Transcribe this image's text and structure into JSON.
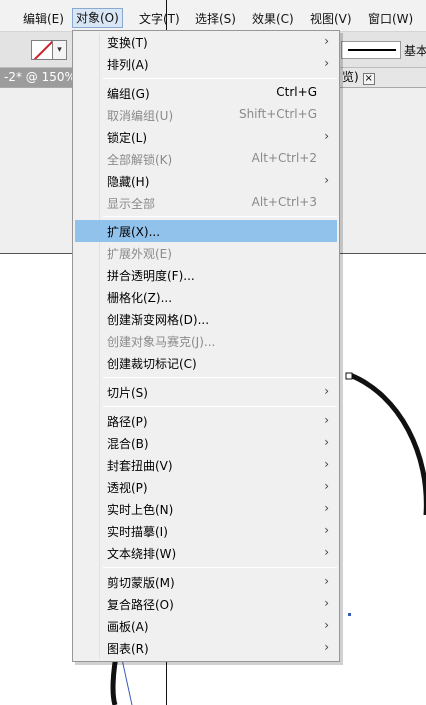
{
  "menubar": {
    "items": [
      {
        "label": "编辑(E)"
      },
      {
        "label": "对象(O)"
      },
      {
        "label": "文字(T)"
      },
      {
        "label": "选择(S)"
      },
      {
        "label": "效果(C)"
      },
      {
        "label": "视图(V)"
      },
      {
        "label": "窗口(W)"
      }
    ]
  },
  "controlbar": {
    "stroke_style_label": "基本"
  },
  "tabs": {
    "left": "-2* @ 150%",
    "right": "览)",
    "close": "×"
  },
  "menu": {
    "items": [
      {
        "label": "变换(T)",
        "shortcut": "",
        "submenu": true
      },
      {
        "label": "排列(A)",
        "shortcut": "",
        "submenu": true
      },
      {
        "label": "编组(G)",
        "shortcut": "Ctrl+G",
        "submenu": false
      },
      {
        "label": "取消编组(U)",
        "shortcut": "Shift+Ctrl+G",
        "submenu": false
      },
      {
        "label": "锁定(L)",
        "shortcut": "",
        "submenu": true
      },
      {
        "label": "全部解锁(K)",
        "shortcut": "Alt+Ctrl+2",
        "submenu": false
      },
      {
        "label": "隐藏(H)",
        "shortcut": "",
        "submenu": true
      },
      {
        "label": "显示全部",
        "shortcut": "Alt+Ctrl+3",
        "submenu": false
      },
      {
        "label": "扩展(X)...",
        "shortcut": "",
        "submenu": false
      },
      {
        "label": "扩展外观(E)",
        "shortcut": "",
        "submenu": false
      },
      {
        "label": "拼合透明度(F)...",
        "shortcut": "",
        "submenu": false
      },
      {
        "label": "栅格化(Z)...",
        "shortcut": "",
        "submenu": false
      },
      {
        "label": "创建渐变网格(D)...",
        "shortcut": "",
        "submenu": false
      },
      {
        "label": "创建对象马赛克(J)...",
        "shortcut": "",
        "submenu": false
      },
      {
        "label": "创建裁切标记(C)",
        "shortcut": "",
        "submenu": false
      },
      {
        "label": "切片(S)",
        "shortcut": "",
        "submenu": true
      },
      {
        "label": "路径(P)",
        "shortcut": "",
        "submenu": true
      },
      {
        "label": "混合(B)",
        "shortcut": "",
        "submenu": true
      },
      {
        "label": "封套扭曲(V)",
        "shortcut": "",
        "submenu": true
      },
      {
        "label": "透视(P)",
        "shortcut": "",
        "submenu": true
      },
      {
        "label": "实时上色(N)",
        "shortcut": "",
        "submenu": true
      },
      {
        "label": "实时描摹(I)",
        "shortcut": "",
        "submenu": true
      },
      {
        "label": "文本绕排(W)",
        "shortcut": "",
        "submenu": true
      },
      {
        "label": "剪切蒙版(M)",
        "shortcut": "",
        "submenu": true
      },
      {
        "label": "复合路径(O)",
        "shortcut": "",
        "submenu": true
      },
      {
        "label": "画板(A)",
        "shortcut": "",
        "submenu": true
      },
      {
        "label": "图表(R)",
        "shortcut": "",
        "submenu": true
      }
    ],
    "highlighted_color": "#91c2ec",
    "disabled_color": "#8a8a8a",
    "arrow_glyph": "›"
  }
}
